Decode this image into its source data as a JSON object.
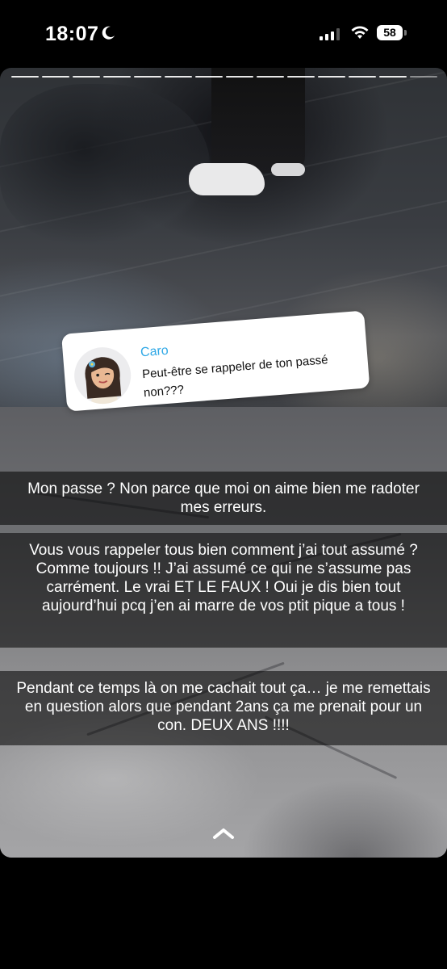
{
  "status_bar": {
    "time": "18:07",
    "battery": "58",
    "icons": [
      "moon-icon",
      "signal-icon",
      "wifi-icon",
      "battery-icon"
    ]
  },
  "story": {
    "progress_segments_total": 14,
    "progress_segments_viewed": 13,
    "reply": {
      "name": "Caro",
      "text": "Peut-être se rappeler de ton passé non???"
    },
    "captions": [
      "Mon passe ? Non parce que moi on aime bien me radoter mes erreurs.",
      "Vous vous rappeler tous bien comment j’ai tout assumé ? Comme toujours !! J’ai assumé ce qui ne s’assume pas carrément. Le vrai ET LE FAUX ! Oui je dis bien tout aujourd’hui pcq j’en ai marre de vos ptit pique a tous !",
      "Pendant ce temps là on me cachait tout ça… je me remettais en question alors que pendant 2ans ça me prenait pour un con. DEUX ANS !!!!"
    ],
    "swipe_up_icon": "chevron-up-icon"
  },
  "colors": {
    "reply_name": "#2fa8e6",
    "caption_bg": "rgba(0,0,0,0.55)"
  }
}
